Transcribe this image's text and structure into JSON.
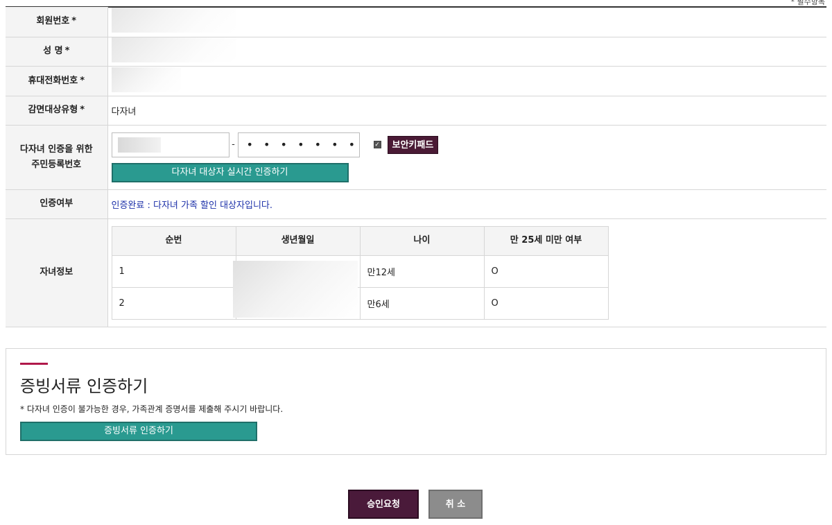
{
  "required_note": "* 필수항목",
  "form": {
    "member_no_label": "회원번호",
    "name_label": "성 명",
    "phone_label": "휴대전화번호",
    "discount_type_label": "감면대상유형",
    "discount_type_value": "다자녀",
    "ssn_label_line1": "다자녀 인증을 위한",
    "ssn_label_line2": "주민등록번호",
    "ssn_dash": "-",
    "ssn_back_masked": "• • • • • • •",
    "keypad_label": "보안키패드",
    "realtime_auth_button": "다자녀 대상자 실시간 인증하기",
    "auth_status_label": "인증여부",
    "auth_status_value": "인증완료 : 다자녀 가족 할인 대상자입니다.",
    "children_label": "자녀정보",
    "required_mark": "*"
  },
  "children_table": {
    "headers": [
      "순번",
      "생년월일",
      "나이",
      "만 25세 미만 여부"
    ],
    "rows": [
      {
        "no": "1",
        "age": "만12세",
        "under25": "O"
      },
      {
        "no": "2",
        "age": "만6세",
        "under25": "O"
      }
    ]
  },
  "document_section": {
    "title": "증빙서류 인증하기",
    "note": "* 다자녀 인증이 불가능한 경우, 가족관계 증명서를 제출해 주시기 바랍니다.",
    "button": "증빙서류 인증하기"
  },
  "actions": {
    "approve": "승인요청",
    "cancel": "취 소"
  }
}
